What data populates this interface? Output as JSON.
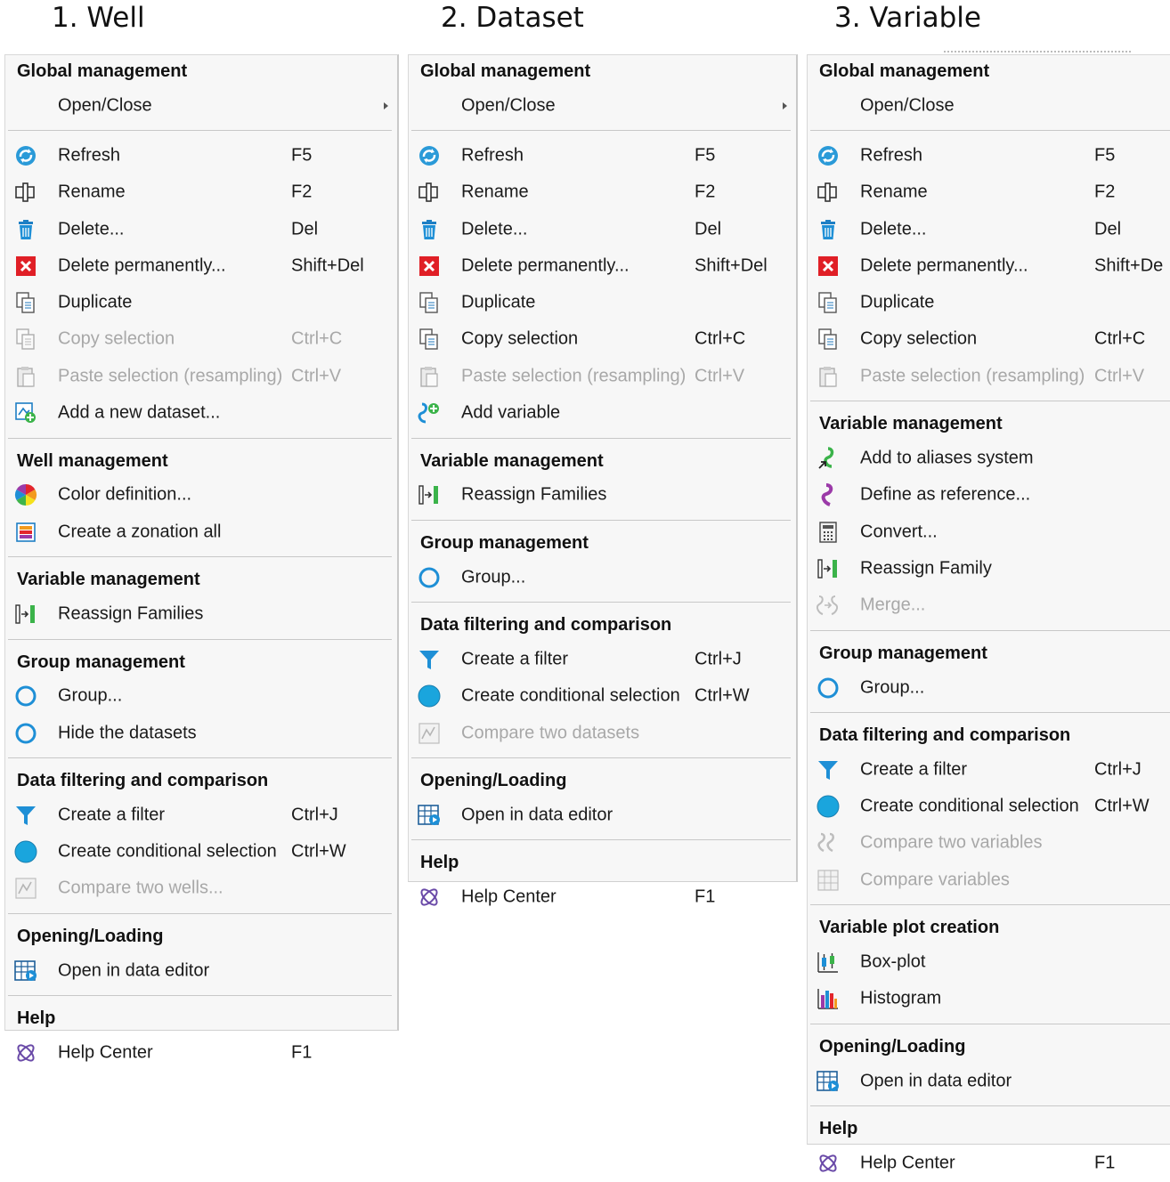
{
  "columns": [
    {
      "id": "well",
      "title": "1. Well",
      "sections": [
        {
          "header": "Global management",
          "items": [
            {
              "label": "Open/Close",
              "shortcut": "",
              "icon": "none",
              "submenu": true
            }
          ]
        },
        {
          "header": "",
          "items": [
            {
              "label": "Refresh",
              "shortcut": "F5",
              "icon": "refresh"
            },
            {
              "label": "Rename",
              "shortcut": "F2",
              "icon": "rename"
            },
            {
              "label": "Delete...",
              "shortcut": "Del",
              "icon": "trash"
            },
            {
              "label": "Delete permanently...",
              "shortcut": "Shift+Del",
              "icon": "delete-x"
            },
            {
              "label": "Duplicate",
              "shortcut": "",
              "icon": "duplicate"
            },
            {
              "label": "Copy selection",
              "shortcut": "Ctrl+C",
              "icon": "copy",
              "disabled": true
            },
            {
              "label": "Paste selection (resampling)",
              "shortcut": "Ctrl+V",
              "icon": "paste",
              "disabled": true
            },
            {
              "label": "Add a new dataset...",
              "shortcut": "",
              "icon": "add-dataset"
            }
          ]
        },
        {
          "header": "Well management",
          "items": [
            {
              "label": "Color definition...",
              "shortcut": "",
              "icon": "color-wheel"
            },
            {
              "label": "Create a zonation all",
              "shortcut": "",
              "icon": "zonation"
            }
          ]
        },
        {
          "header": "Variable management",
          "items": [
            {
              "label": "Reassign Families",
              "shortcut": "",
              "icon": "reassign"
            }
          ]
        },
        {
          "header": "Group management",
          "items": [
            {
              "label": "Group...",
              "shortcut": "",
              "icon": "ring"
            },
            {
              "label": "Hide the datasets",
              "shortcut": "",
              "icon": "ring"
            }
          ]
        },
        {
          "header": "Data filtering and comparison",
          "items": [
            {
              "label": "Create a filter",
              "shortcut": "Ctrl+J",
              "icon": "funnel"
            },
            {
              "label": "Create conditional selection",
              "shortcut": "Ctrl+W",
              "icon": "disc"
            },
            {
              "label": "Compare two wells...",
              "shortcut": "",
              "icon": "compare",
              "disabled": true
            }
          ]
        },
        {
          "header": "Opening/Loading",
          "items": [
            {
              "label": "Open in data editor",
              "shortcut": "",
              "icon": "data-editor"
            }
          ]
        },
        {
          "header": "Help",
          "items": [
            {
              "label": "Help Center",
              "shortcut": "F1",
              "icon": "help"
            }
          ]
        }
      ]
    },
    {
      "id": "dataset",
      "title": "2. Dataset",
      "sections": [
        {
          "header": "Global management",
          "items": [
            {
              "label": "Open/Close",
              "shortcut": "",
              "icon": "none",
              "submenu": true
            }
          ]
        },
        {
          "header": "",
          "items": [
            {
              "label": "Refresh",
              "shortcut": "F5",
              "icon": "refresh"
            },
            {
              "label": "Rename",
              "shortcut": "F2",
              "icon": "rename"
            },
            {
              "label": "Delete...",
              "shortcut": "Del",
              "icon": "trash"
            },
            {
              "label": "Delete permanently...",
              "shortcut": "Shift+Del",
              "icon": "delete-x"
            },
            {
              "label": "Duplicate",
              "shortcut": "",
              "icon": "duplicate"
            },
            {
              "label": "Copy selection",
              "shortcut": "Ctrl+C",
              "icon": "copy"
            },
            {
              "label": "Paste selection (resampling)",
              "shortcut": "Ctrl+V",
              "icon": "paste",
              "disabled": true
            },
            {
              "label": "Add variable",
              "shortcut": "",
              "icon": "add-variable"
            }
          ]
        },
        {
          "header": "Variable management",
          "items": [
            {
              "label": "Reassign Families",
              "shortcut": "",
              "icon": "reassign"
            }
          ]
        },
        {
          "header": "Group management",
          "items": [
            {
              "label": "Group...",
              "shortcut": "",
              "icon": "ring"
            }
          ]
        },
        {
          "header": "Data filtering and comparison",
          "items": [
            {
              "label": "Create a filter",
              "shortcut": "Ctrl+J",
              "icon": "funnel"
            },
            {
              "label": "Create conditional selection",
              "shortcut": "Ctrl+W",
              "icon": "disc"
            },
            {
              "label": "Compare two datasets",
              "shortcut": "",
              "icon": "compare",
              "disabled": true
            }
          ]
        },
        {
          "header": "Opening/Loading",
          "items": [
            {
              "label": "Open in data editor",
              "shortcut": "",
              "icon": "data-editor"
            }
          ]
        },
        {
          "header": "Help",
          "items": [
            {
              "label": "Help Center",
              "shortcut": "F1",
              "icon": "help"
            }
          ]
        }
      ]
    },
    {
      "id": "variable",
      "title": "3. Variable",
      "sections": [
        {
          "header": "Global management",
          "items": [
            {
              "label": "Open/Close",
              "shortcut": "",
              "icon": "none"
            }
          ]
        },
        {
          "header": "",
          "items": [
            {
              "label": "Refresh",
              "shortcut": "F5",
              "icon": "refresh"
            },
            {
              "label": "Rename",
              "shortcut": "F2",
              "icon": "rename"
            },
            {
              "label": "Delete...",
              "shortcut": "Del",
              "icon": "trash"
            },
            {
              "label": "Delete permanently...",
              "shortcut": "Shift+De",
              "icon": "delete-x"
            },
            {
              "label": "Duplicate",
              "shortcut": "",
              "icon": "duplicate"
            },
            {
              "label": "Copy selection",
              "shortcut": "Ctrl+C",
              "icon": "copy"
            },
            {
              "label": "Paste selection (resampling)",
              "shortcut": "Ctrl+V",
              "icon": "paste",
              "disabled": true
            }
          ]
        },
        {
          "header": "Variable management",
          "items": [
            {
              "label": "Add to aliases system",
              "shortcut": "",
              "icon": "alias"
            },
            {
              "label": "Define as reference...",
              "shortcut": "",
              "icon": "reference"
            },
            {
              "label": "Convert...",
              "shortcut": "",
              "icon": "calculator"
            },
            {
              "label": "Reassign Family",
              "shortcut": "",
              "icon": "reassign"
            },
            {
              "label": "Merge...",
              "shortcut": "",
              "icon": "merge",
              "disabled": true
            }
          ]
        },
        {
          "header": "Group management",
          "items": [
            {
              "label": "Group...",
              "shortcut": "",
              "icon": "ring"
            }
          ]
        },
        {
          "header": "Data filtering and comparison",
          "items": [
            {
              "label": "Create a filter",
              "shortcut": "Ctrl+J",
              "icon": "funnel"
            },
            {
              "label": "Create conditional selection",
              "shortcut": "Ctrl+W",
              "icon": "disc"
            },
            {
              "label": "Compare two variables",
              "shortcut": "",
              "icon": "compare-variables",
              "disabled": true
            },
            {
              "label": "Compare variables",
              "shortcut": "",
              "icon": "compare-grid",
              "disabled": true
            }
          ]
        },
        {
          "header": "Variable plot creation",
          "items": [
            {
              "label": "Box-plot",
              "shortcut": "",
              "icon": "boxplot"
            },
            {
              "label": "Histogram",
              "shortcut": "",
              "icon": "histogram"
            }
          ]
        },
        {
          "header": "Opening/Loading",
          "items": [
            {
              "label": "Open in data editor",
              "shortcut": "",
              "icon": "data-editor"
            }
          ]
        },
        {
          "header": "Help",
          "items": [
            {
              "label": "Help Center",
              "shortcut": "F1",
              "icon": "help"
            }
          ]
        }
      ]
    }
  ],
  "colors": {
    "accent_blue": "#1e8fd6",
    "delete_red": "#e01f26",
    "disabled_text": "#a8a8a8",
    "menu_bg": "#f7f7f7",
    "separator": "#c8c8c8"
  }
}
